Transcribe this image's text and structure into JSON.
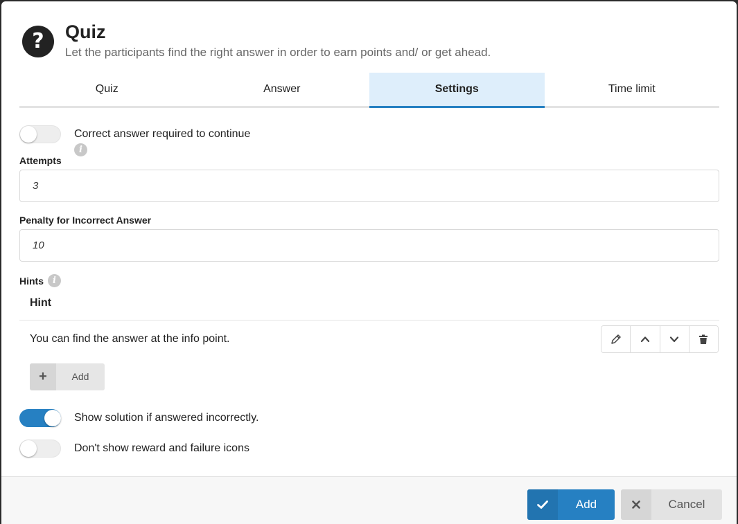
{
  "header": {
    "icon": "question-circle-icon",
    "title": "Quiz",
    "subtitle": "Let the participants find the right answer in order to earn points and/ or get ahead."
  },
  "tabs": [
    {
      "label": "Quiz",
      "active": false
    },
    {
      "label": "Answer",
      "active": false
    },
    {
      "label": "Settings",
      "active": true
    },
    {
      "label": "Time limit",
      "active": false
    }
  ],
  "settings": {
    "correct_required": {
      "label": "Correct answer required to continue",
      "enabled": false
    },
    "attempts": {
      "label": "Attempts",
      "value": "3"
    },
    "penalty": {
      "label": "Penalty for Incorrect Answer",
      "value": "10"
    },
    "show_solution": {
      "label": "Show solution if answered incorrectly.",
      "enabled": true
    },
    "hide_icons": {
      "label": "Don't show reward and failure icons",
      "enabled": false
    }
  },
  "hints": {
    "label": "Hints",
    "column_header": "Hint",
    "items": [
      {
        "text": "You can find the answer at the info point."
      }
    ],
    "add_label": "Add"
  },
  "footer": {
    "add_label": "Add",
    "cancel_label": "Cancel"
  },
  "colors": {
    "accent": "#2680c2",
    "active_tab_bg": "#deeefb"
  }
}
